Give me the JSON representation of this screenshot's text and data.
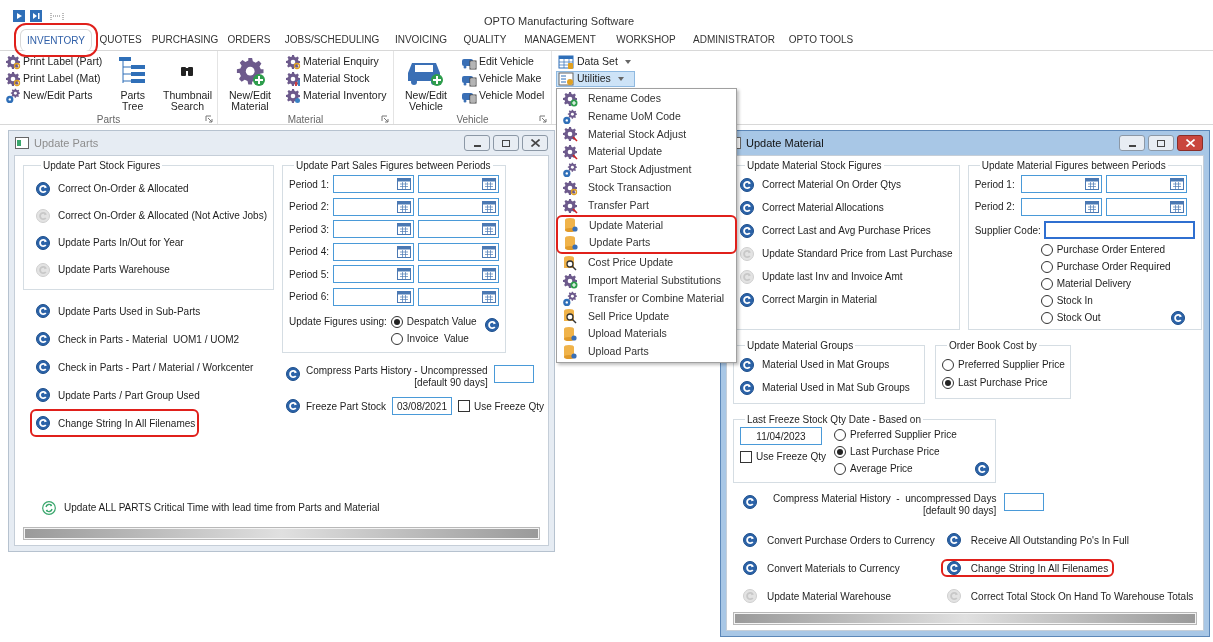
{
  "app_title": "OPTO Manufacturing Software",
  "tabs": [
    {
      "label": "INVENTORY",
      "selected": true,
      "highlighted": true
    },
    {
      "label": "QUOTES",
      "selected": false,
      "highlighted": false
    },
    {
      "label": "PURCHASING",
      "selected": false,
      "highlighted": false
    },
    {
      "label": "ORDERS",
      "selected": false,
      "highlighted": false
    },
    {
      "label": "JOBS/SCHEDULING",
      "selected": false,
      "highlighted": false
    },
    {
      "label": "INVOICING",
      "selected": false,
      "highlighted": false
    },
    {
      "label": "QUALITY",
      "selected": false,
      "highlighted": false
    },
    {
      "label": "MANAGEMENT",
      "selected": false,
      "highlighted": false
    },
    {
      "label": "WORKSHOP",
      "selected": false,
      "highlighted": false
    },
    {
      "label": "ADMINISTRATOR",
      "selected": false,
      "highlighted": false
    },
    {
      "label": "OPTO TOOLS",
      "selected": false,
      "highlighted": false
    }
  ],
  "ribbon": {
    "groups": [
      {
        "label": "Parts",
        "columns": [
          {
            "kind": "stack",
            "items": [
              {
                "label": "Print Label (Part)"
              },
              {
                "label": "Print Label (Mat)"
              },
              {
                "label": "New/Edit Parts"
              }
            ]
          },
          {
            "kind": "large",
            "label": "Parts Tree"
          },
          {
            "kind": "large",
            "label": "Thumbnail Search"
          }
        ]
      },
      {
        "label": "Material",
        "columns": [
          {
            "kind": "large",
            "label": "New/Edit Material"
          },
          {
            "kind": "stack",
            "items": [
              {
                "label": "Material Enquiry"
              },
              {
                "label": "Material Stock"
              },
              {
                "label": "Material Inventory"
              }
            ]
          }
        ]
      },
      {
        "label": "Vehicle",
        "columns": [
          {
            "kind": "large",
            "label": "New/Edit Vehicle"
          },
          {
            "kind": "stack",
            "items": [
              {
                "label": "Edit Vehicle"
              },
              {
                "label": "Vehicle Make"
              },
              {
                "label": "Vehicle Model"
              }
            ]
          }
        ]
      },
      {
        "columns": [
          {
            "kind": "dropdowns",
            "items": [
              {
                "label": "Data Set",
                "expanded": false
              },
              {
                "label": "Utilities",
                "expanded": true
              }
            ]
          }
        ]
      }
    ]
  },
  "menu": {
    "items": [
      {
        "label": "Rename Codes",
        "highlighted": false
      },
      {
        "label": "Rename UoM Code",
        "highlighted": false
      },
      {
        "label": "Material Stock Adjust",
        "highlighted": false
      },
      {
        "label": "Material Update",
        "highlighted": false
      },
      {
        "label": "Part Stock Adjustment",
        "highlighted": false
      },
      {
        "label": "Stock Transaction",
        "highlighted": false
      },
      {
        "label": "Transfer Part",
        "highlighted": false
      },
      {
        "label": "Update Material",
        "highlighted": true
      },
      {
        "label": "Update Parts",
        "highlighted": true
      },
      {
        "label": "Cost Price Update",
        "highlighted": false
      },
      {
        "label": "Import Material Substitutions",
        "highlighted": false
      },
      {
        "label": "Transfer or Combine Material",
        "highlighted": false
      },
      {
        "label": "Sell Price Update",
        "highlighted": false
      },
      {
        "label": "Upload Materials",
        "highlighted": false
      },
      {
        "label": "Upload Parts",
        "highlighted": false
      }
    ]
  },
  "parts_window": {
    "title": "Update Parts",
    "active": false,
    "stock_group": {
      "title": "Update Part Stock Figures",
      "actions": [
        {
          "label": "Correct On-Order & Allocated",
          "enabled": true,
          "highlighted": false
        },
        {
          "label": "Correct On-Order & Allocated (Not Active Jobs)",
          "enabled": false,
          "highlighted": false
        },
        {
          "label": "Update Parts In/Out for Year",
          "enabled": true,
          "highlighted": false
        },
        {
          "label": "Update Parts Warehouse",
          "enabled": false,
          "highlighted": false
        }
      ]
    },
    "actions": [
      {
        "label": "Update Parts Used in Sub-Parts",
        "enabled": true,
        "highlighted": false
      },
      {
        "label": "Check in Parts - Material  UOM1 / UOM2",
        "enabled": true,
        "highlighted": false
      },
      {
        "label": "Check in Parts - Part / Material / Workcenter",
        "enabled": true,
        "highlighted": false
      },
      {
        "label": "Update Parts / Part Group Used",
        "enabled": true,
        "highlighted": false
      },
      {
        "label": "Change String In All Filenames",
        "enabled": true,
        "highlighted": true
      }
    ],
    "sales_group": {
      "title": "Update Part Sales Figures between Periods",
      "periods": [
        "Period 1:",
        "Period 2:",
        "Period 3:",
        "Period 4:",
        "Period 5:",
        "Period 6:"
      ],
      "using_label": "Update Figures using:",
      "options": [
        {
          "label": "Despatch Value",
          "selected": true
        },
        {
          "label": "Invoice  Value",
          "selected": false
        }
      ]
    },
    "compress": {
      "label": "Compress Parts History - Uncompressed",
      "note": "[default 90 days]"
    },
    "freeze": {
      "label": "Freeze Part Stock",
      "date": "03/08/2021",
      "checkbox": {
        "label": "Use Freeze Qty",
        "checked": false
      }
    },
    "critical": {
      "label": "Update ALL PARTS Critical Time with lead time from Parts and Material",
      "kind": "sync"
    },
    "progress": {
      "level": 1
    }
  },
  "material_window": {
    "title": "Update Material",
    "active": true,
    "stock_group": {
      "title": "Update Material Stock Figures",
      "actions": [
        {
          "label": "Correct Material On Order Qtys",
          "enabled": true
        },
        {
          "label": "Correct Material Allocations",
          "enabled": true
        },
        {
          "label": "Correct Last and Avg Purchase Prices",
          "enabled": true
        },
        {
          "label": "Update Standard Price from Last Purchase",
          "enabled": false
        },
        {
          "label": "Update last Inv and Invoice Amt",
          "enabled": false
        },
        {
          "label": "Correct Margin in Material",
          "enabled": true
        }
      ]
    },
    "periods_group": {
      "title": "Update Material Figures between Periods",
      "periods": [
        "Period 1:",
        "Period 2:"
      ],
      "supplier_label": "Supplier Code:",
      "options": [
        {
          "label": "Purchase Order Entered",
          "selected": false
        },
        {
          "label": "Purchase Order Required",
          "selected": false
        },
        {
          "label": "Material Delivery",
          "selected": false
        },
        {
          "label": "Stock In",
          "selected": false
        },
        {
          "label": "Stock Out",
          "selected": false
        }
      ]
    },
    "groups_group": {
      "title": "Update Material Groups",
      "actions": [
        {
          "label": "Material Used in Mat Groups",
          "enabled": true
        },
        {
          "label": "Material Used in Mat Sub Groups",
          "enabled": true
        }
      ]
    },
    "order_book": {
      "title": "Order Book Cost by",
      "options": [
        {
          "label": "Preferred Supplier Price",
          "selected": false
        },
        {
          "label": "Last Purchase Price",
          "selected": true
        }
      ]
    },
    "freeze_group": {
      "title": "Last Freeze Stock Qty Date - Based on",
      "date": "11/04/2023",
      "checkbox": {
        "label": "Use Freeze Qty",
        "checked": false
      },
      "options": [
        {
          "label": "Preferred Supplier Price",
          "selected": false
        },
        {
          "label": "Last Purchase Price",
          "selected": true
        },
        {
          "label": "Average Price",
          "selected": false
        }
      ]
    },
    "compress": {
      "label": "Compress Material History  -  uncompressed Days",
      "note": "[default 90 days]"
    },
    "actions": [
      {
        "label": "Convert Purchase Orders to Currency",
        "enabled": true,
        "highlighted": false
      },
      {
        "label": "Receive All Outstanding Po's In Full",
        "enabled": true,
        "highlighted": false
      },
      {
        "label": "Convert Materials to Currency",
        "enabled": true,
        "highlighted": false
      },
      {
        "label": "Change String In All Filenames",
        "enabled": true,
        "highlighted": true
      },
      {
        "label": "Update Material Warehouse",
        "enabled": false,
        "highlighted": false
      },
      {
        "label": "Correct Total Stock On Hand To Warehouse Totals",
        "enabled": false,
        "highlighted": false
      }
    ],
    "progress": {
      "level": 1
    }
  }
}
